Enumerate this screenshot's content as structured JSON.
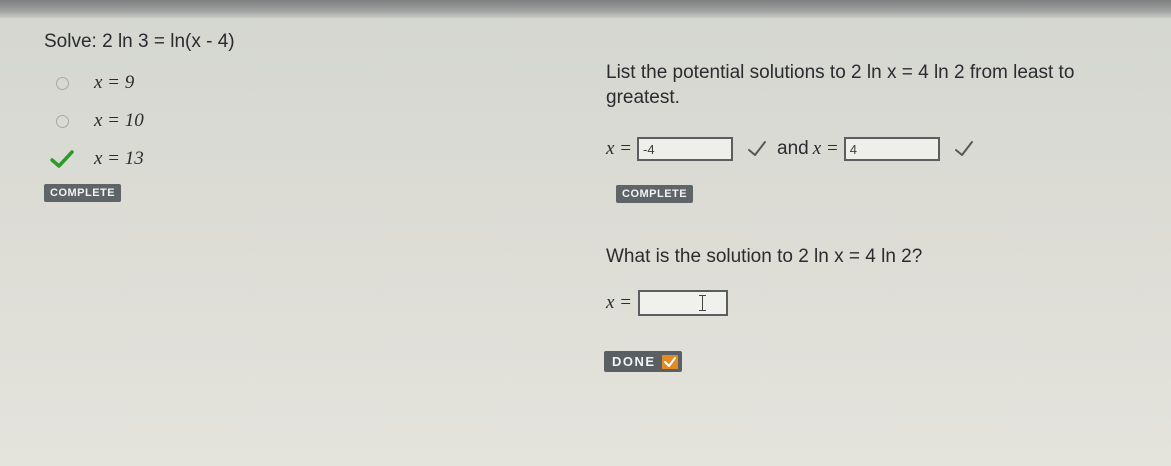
{
  "question1": {
    "label": "Solve:",
    "equation": "2 ln 3 = ln(x - 4)",
    "options": [
      {
        "text": "x = 9",
        "state": "unselected"
      },
      {
        "text": "x = 10",
        "state": "unselected"
      },
      {
        "text": "x = 13",
        "state": "correct"
      }
    ],
    "badge": "COMPLETE"
  },
  "question2": {
    "prompt": "List the potential solutions to 2 ln x = 4 ln 2 from least to greatest.",
    "x_label_1": "x =",
    "answer1": "-4",
    "and_label": "and",
    "x_label_2": "x =",
    "answer2": "4",
    "badge": "COMPLETE"
  },
  "question3": {
    "prompt": "What is the solution to 2 ln x = 4 ln 2?",
    "x_label": "x =",
    "input_value": "",
    "done_label": "DONE"
  },
  "colors": {
    "check_green": "#2e9a2a",
    "badge_bg": "#5f6468",
    "done_accent": "#e38b23"
  }
}
